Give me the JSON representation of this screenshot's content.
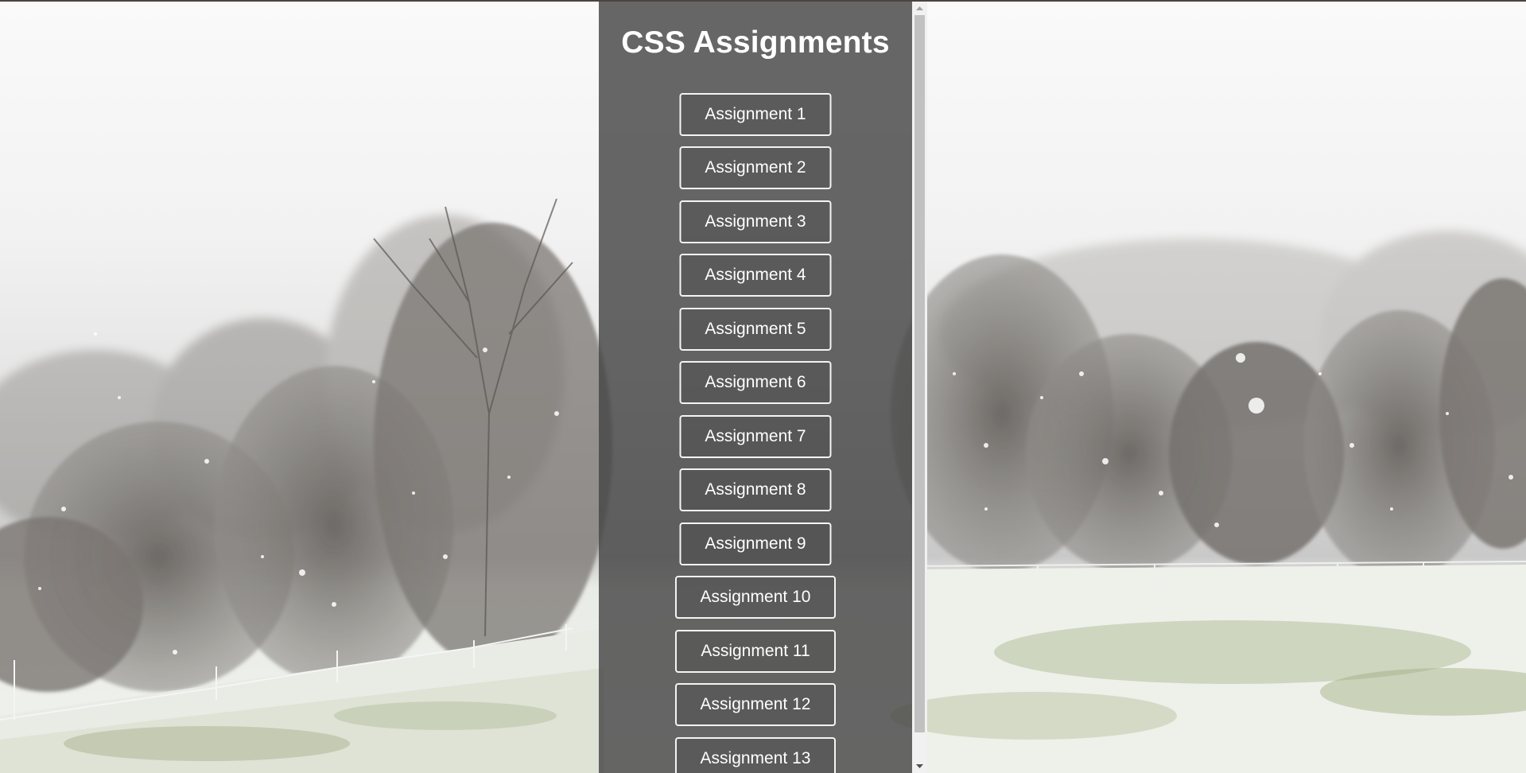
{
  "page": {
    "title": "CSS Assignments"
  },
  "assignments": [
    {
      "label": "Assignment 1"
    },
    {
      "label": "Assignment 2"
    },
    {
      "label": "Assignment 3"
    },
    {
      "label": "Assignment 4"
    },
    {
      "label": "Assignment 5"
    },
    {
      "label": "Assignment 6"
    },
    {
      "label": "Assignment 7"
    },
    {
      "label": "Assignment 8"
    },
    {
      "label": "Assignment 9"
    },
    {
      "label": "Assignment 10"
    },
    {
      "label": "Assignment 11"
    },
    {
      "label": "Assignment 12"
    },
    {
      "label": "Assignment 13"
    }
  ],
  "scrollbar": {
    "up_icon": "triangle-up-icon",
    "down_icon": "triangle-down-icon"
  },
  "colors": {
    "panel": "#464646",
    "text": "#ffffff",
    "button_border": "#f4f4f4"
  }
}
